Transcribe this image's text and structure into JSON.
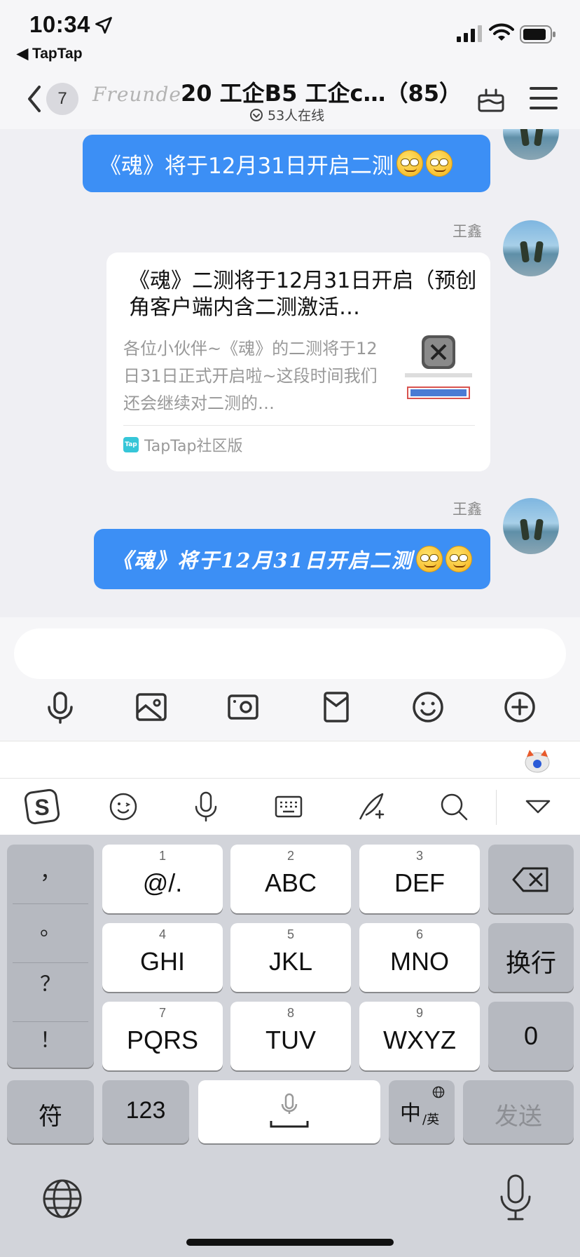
{
  "status_bar": {
    "time": "10:34",
    "back_app": "◀ TapTap"
  },
  "nav": {
    "unread_count": "7",
    "brand_logo": "Freunde",
    "title": "20 工企B5 工企c…（85）",
    "online_text": "53人在线"
  },
  "messages": [
    {
      "type": "text",
      "text": "《魂》将于12月31日开启二测"
    },
    {
      "type": "card",
      "sender": "王鑫",
      "title": "《魂》二测将于12月31日开启（预创角客户端内含二测激活…",
      "desc": "各位小伙伴~《魂》的二测将于12日31日正式开启啦~这段时间我们还会继续对二测的…",
      "source": "TapTap社区版"
    },
    {
      "type": "text",
      "sender": "王鑫",
      "text": "《魂》将于12月31日开启二测"
    }
  ],
  "input": {
    "placeholder": ""
  },
  "keyboard": {
    "punctuation": [
      "，",
      "。",
      "？",
      "！"
    ],
    "rows": [
      [
        {
          "num": "1",
          "label": "@/."
        },
        {
          "num": "2",
          "label": "ABC"
        },
        {
          "num": "3",
          "label": "DEF"
        }
      ],
      [
        {
          "num": "4",
          "label": "GHI"
        },
        {
          "num": "5",
          "label": "JKL"
        },
        {
          "num": "6",
          "label": "MNO"
        }
      ],
      [
        {
          "num": "7",
          "label": "PQRS"
        },
        {
          "num": "8",
          "label": "TUV"
        },
        {
          "num": "9",
          "label": "WXYZ"
        }
      ]
    ],
    "return_label": "换行",
    "zero_label": "0",
    "symbol_label": "符",
    "numbers_label": "123",
    "lang_main": "中",
    "lang_sub": "/英",
    "send_label": "发送"
  },
  "colors": {
    "accent_blue": "#3c8ff5",
    "keyboard_bg": "#d2d4da"
  }
}
